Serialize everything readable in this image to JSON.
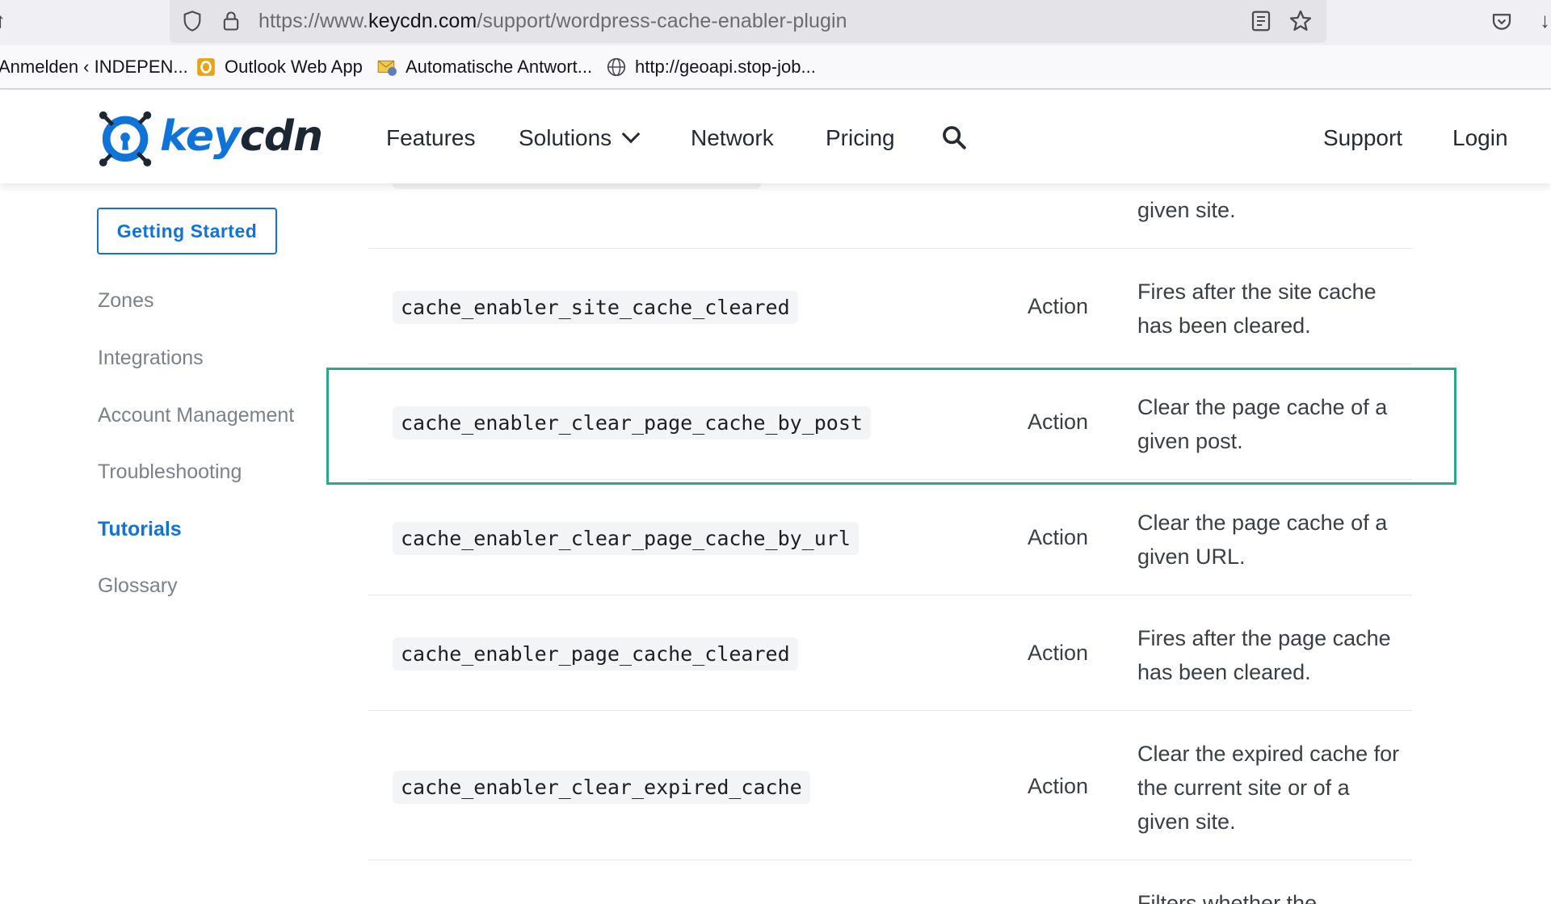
{
  "browser": {
    "url_prefix": "https://www.",
    "url_domain": "keycdn.com",
    "url_path": "/support/wordpress-cache-enabler-plugin",
    "bookmarks": [
      {
        "label": "Anmelden ‹ INDEPEN...",
        "icon": "none"
      },
      {
        "label": "Outlook Web App",
        "icon": "outlook-icon"
      },
      {
        "label": "Automatische Antwort...",
        "icon": "mail-settings-icon"
      },
      {
        "label": "http://geoapi.stop-job...",
        "icon": "globe-icon"
      }
    ]
  },
  "header": {
    "logo_key": "key",
    "logo_cdn": "cdn",
    "nav": [
      "Features",
      "Solutions",
      "Network",
      "Pricing"
    ],
    "support": "Support",
    "login": "Login"
  },
  "sidebar": {
    "getting_started": "Getting Started",
    "items": [
      "Zones",
      "Integrations",
      "Account Management",
      "Troubleshooting",
      "Tutorials",
      "Glossary"
    ],
    "active": "Tutorials",
    "active_color": "#0f73d8"
  },
  "table": {
    "top_fragment": "given site.",
    "rows": [
      {
        "hook": "cache_enabler_site_cache_cleared",
        "type": "Action",
        "desc": "Fires after the site cache has been cleared."
      },
      {
        "hook": "cache_enabler_clear_page_cache_by_post",
        "type": "Action",
        "desc": "Clear the page cache of a given post."
      },
      {
        "hook": "cache_enabler_clear_page_cache_by_url",
        "type": "Action",
        "desc": "Clear the page cache of a given URL."
      },
      {
        "hook": "cache_enabler_page_cache_cleared",
        "type": "Action",
        "desc": "Fires after the page cache has been cleared."
      },
      {
        "hook": "cache_enabler_clear_expired_cache",
        "type": "Action",
        "desc": "Clear the expired cache for the current site or of a given site."
      }
    ],
    "bottom_fragment": "Filters whether the",
    "highlight_color": "#2aa889"
  }
}
